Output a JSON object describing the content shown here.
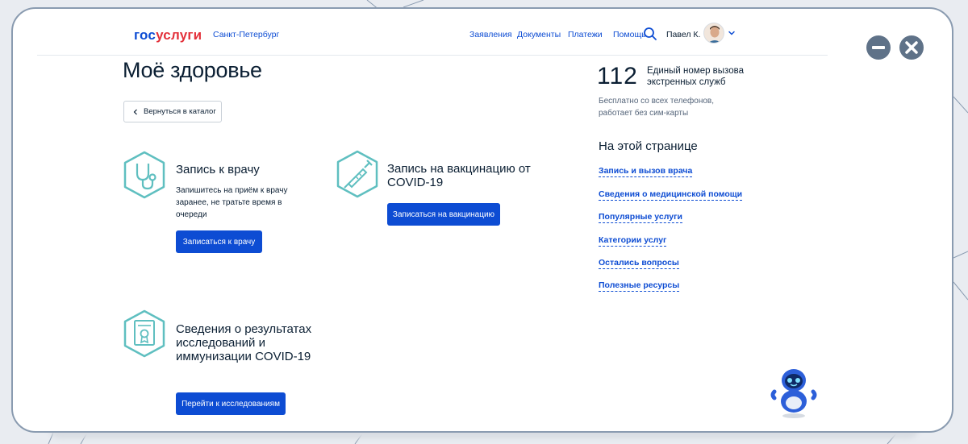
{
  "header": {
    "logo_part1": "гос",
    "logo_part2": "услуги",
    "city": "Санкт-Петербург",
    "nav": [
      "Заявления",
      "Документы",
      "Платежи",
      "Помощь"
    ],
    "user_name": "Павел К."
  },
  "main": {
    "title": "Моё здоровье",
    "back_label": "Вернуться в каталог",
    "services": [
      {
        "title": "Запись к врачу",
        "description": "Запишитесь на приём к врачу заранее, не тратьте время в очереди",
        "button": "Записаться к врачу",
        "icon": "stethoscope-icon"
      },
      {
        "title": "Запись на вакцинацию от COVID-19",
        "button": "Записаться на вакцинацию",
        "icon": "syringe-icon"
      },
      {
        "title": "Сведения о результатах исследований и иммунизации COVID-19",
        "button": "Перейти к исследованиям",
        "icon": "certificate-icon"
      }
    ]
  },
  "sidebar": {
    "emergency_number": "112",
    "emergency_label": "Единый номер вызова экстренных служб",
    "emergency_note": "Бесплатно со всех телефонов, работает без сим-карты",
    "toc_title": "На этой странице",
    "toc_links": [
      "Запись и вызов врача",
      "Сведения о медицинской помощи",
      "Популярные услуги",
      "Категории услуг",
      "Остались вопросы",
      "Полезные ресурсы"
    ]
  },
  "colors": {
    "brand_blue": "#0d4cd3",
    "brand_red": "#e3303a",
    "icon_teal": "#5fbfc0",
    "window_control": "#5f7288"
  }
}
